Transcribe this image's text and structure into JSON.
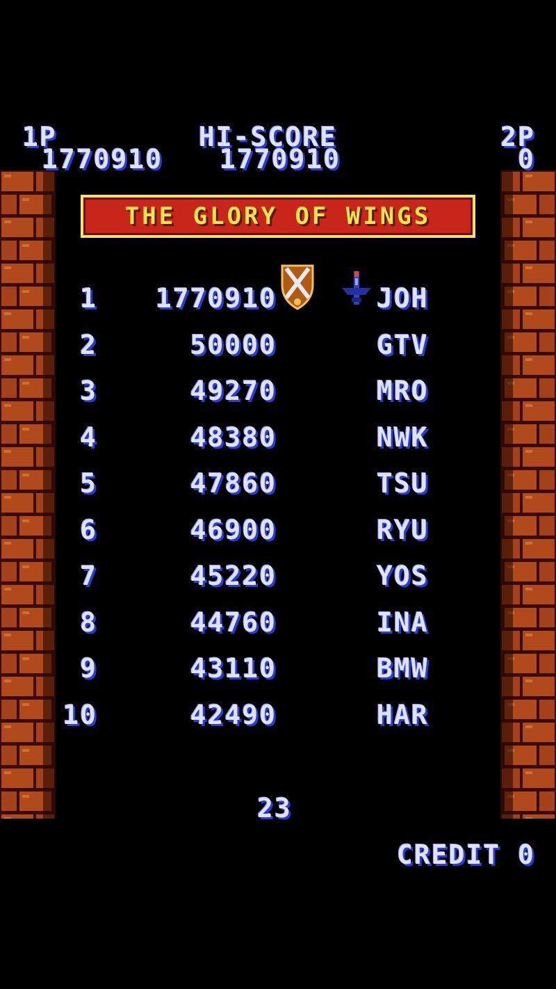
{
  "hud": {
    "p1_label": "1P",
    "p1_score": "1770910",
    "hiscore_label": "HI-SCORE",
    "hiscore_value": "1770910",
    "p2_label": "2P",
    "p2_score": "0"
  },
  "title": "THE GLORY OF WINGS",
  "rankings": [
    {
      "rank": "1",
      "score": "1770910",
      "name": "JOH"
    },
    {
      "rank": "2",
      "score": "50000",
      "name": "GTV"
    },
    {
      "rank": "3",
      "score": "49270",
      "name": "MRO"
    },
    {
      "rank": "4",
      "score": "48380",
      "name": "NWK"
    },
    {
      "rank": "5",
      "score": "47860",
      "name": "TSU"
    },
    {
      "rank": "6",
      "score": "46900",
      "name": "RYU"
    },
    {
      "rank": "7",
      "score": "45220",
      "name": "YOS"
    },
    {
      "rank": "8",
      "score": "44760",
      "name": "INA"
    },
    {
      "rank": "9",
      "score": "43110",
      "name": "BMW"
    },
    {
      "rank": "10",
      "score": "42490",
      "name": "HAR"
    }
  ],
  "timer": "23",
  "credit": "CREDIT  0",
  "icons": {
    "top_badge": "crossed-swords-shield-icon",
    "top_ship": "fighter-plane-icon"
  },
  "colors": {
    "text": "#dfe3ff",
    "text_shadow": "#2b3bd6",
    "banner_bg": "#c8261a",
    "banner_text": "#f9e34a",
    "brick": "#b04a1c"
  }
}
